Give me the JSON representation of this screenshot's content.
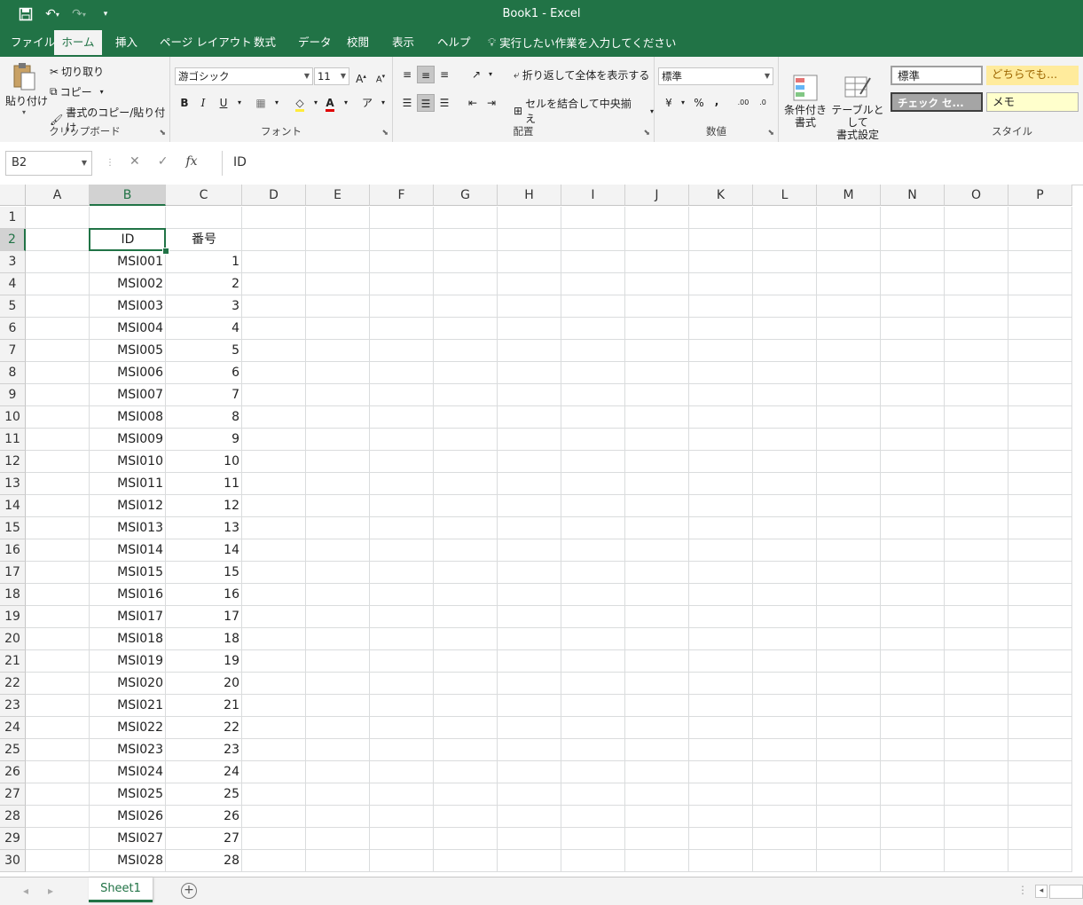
{
  "window": {
    "title": "Book1  -  Excel"
  },
  "qat": {
    "save_icon": "save-icon",
    "undo_icon": "undo-icon",
    "redo_icon": "redo-icon",
    "customize_icon": "customize-icon"
  },
  "menu": {
    "tabs": [
      "ファイル",
      "ホーム",
      "挿入",
      "ページ レイアウト",
      "数式",
      "データ",
      "校閲",
      "表示",
      "ヘルプ"
    ],
    "active_tab": "ホーム",
    "tell_me": "実行したい作業を入力してください"
  },
  "ribbon": {
    "clipboard": {
      "label": "クリップボード",
      "paste": "貼り付け",
      "cut": "切り取り",
      "copy": "コピー",
      "format_painter": "書式のコピー/貼り付け"
    },
    "font": {
      "label": "フォント",
      "font_name": "游ゴシック",
      "font_size": "11",
      "bold": "B",
      "italic": "I",
      "underline": "U"
    },
    "alignment": {
      "label": "配置",
      "wrap_text": "折り返して全体を表示する",
      "merge_center": "セルを結合して中央揃え"
    },
    "number": {
      "label": "数値",
      "format": "標準",
      "percent": "%",
      "comma": ","
    },
    "styles": {
      "label": "スタイル",
      "conditional_format": "条件付き\n書式",
      "format_as_table": "テーブルとして\n書式設定",
      "cell_styles": [
        "標準",
        "どちらでも...",
        "チェック セ...",
        "メモ"
      ]
    }
  },
  "formula_bar": {
    "name_box": "B2",
    "formula": "ID",
    "cancel": "✕",
    "enter": "✓",
    "fx": "fx"
  },
  "columns": [
    "A",
    "B",
    "C",
    "D",
    "E",
    "F",
    "G",
    "H",
    "I",
    "J",
    "K",
    "L",
    "M",
    "N",
    "O",
    "P"
  ],
  "selected_column": "B",
  "rows": [
    "1",
    "2",
    "3",
    "4",
    "5",
    "6",
    "7",
    "8",
    "9",
    "10",
    "11",
    "12",
    "13",
    "14",
    "15",
    "16",
    "17",
    "18",
    "19",
    "20",
    "21",
    "22",
    "23",
    "24",
    "25",
    "26",
    "27",
    "28",
    "29",
    "30"
  ],
  "selected_row": "2",
  "table": {
    "header": [
      "ID",
      "番号"
    ],
    "rows": [
      [
        "MSI001",
        "1"
      ],
      [
        "MSI002",
        "2"
      ],
      [
        "MSI003",
        "3"
      ],
      [
        "MSI004",
        "4"
      ],
      [
        "MSI005",
        "5"
      ],
      [
        "MSI006",
        "6"
      ],
      [
        "MSI007",
        "7"
      ],
      [
        "MSI008",
        "8"
      ],
      [
        "MSI009",
        "9"
      ],
      [
        "MSI010",
        "10"
      ],
      [
        "MSI011",
        "11"
      ],
      [
        "MSI012",
        "12"
      ],
      [
        "MSI013",
        "13"
      ],
      [
        "MSI014",
        "14"
      ],
      [
        "MSI015",
        "15"
      ],
      [
        "MSI016",
        "16"
      ],
      [
        "MSI017",
        "17"
      ],
      [
        "MSI018",
        "18"
      ],
      [
        "MSI019",
        "19"
      ],
      [
        "MSI020",
        "20"
      ],
      [
        "MSI021",
        "21"
      ],
      [
        "MSI022",
        "22"
      ],
      [
        "MSI023",
        "23"
      ],
      [
        "MSI024",
        "24"
      ],
      [
        "MSI025",
        "25"
      ],
      [
        "MSI026",
        "26"
      ],
      [
        "MSI027",
        "27"
      ],
      [
        "MSI028",
        "28"
      ]
    ]
  },
  "sheets": {
    "active": "Sheet1"
  },
  "colors": {
    "accent": "#217346",
    "ribbon_bg": "#f3f3f3",
    "gridline": "#dadcdd"
  }
}
